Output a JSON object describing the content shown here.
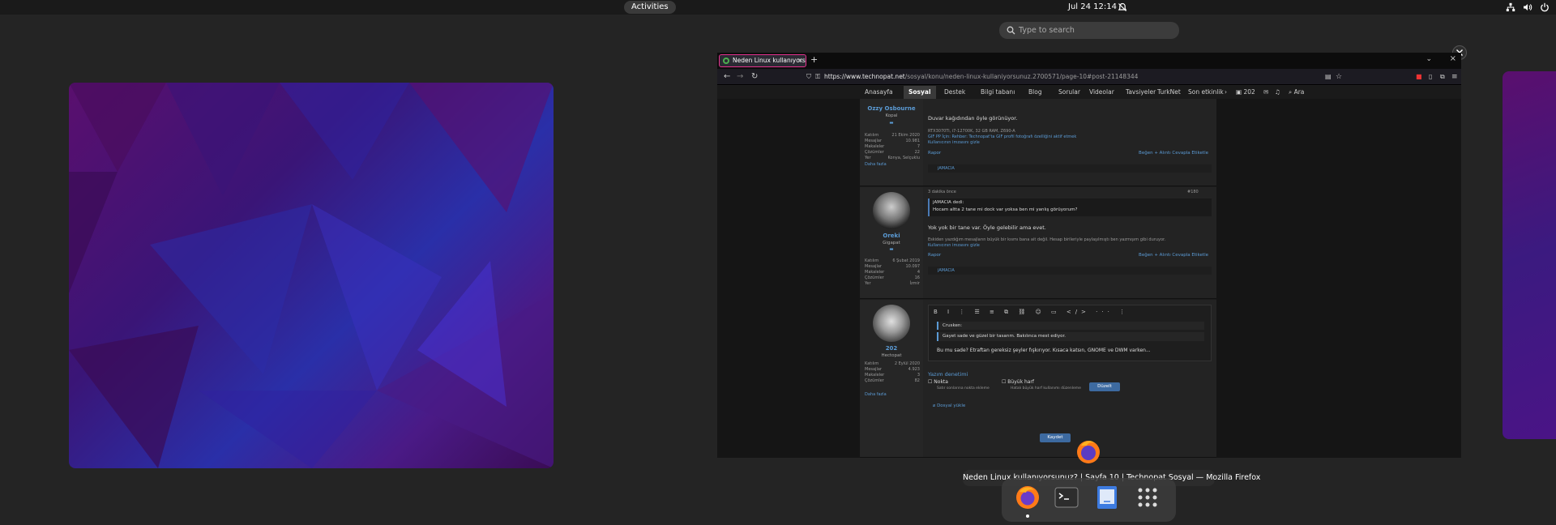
{
  "topbar": {
    "activities": "Activities",
    "clock": "Jul 24  12:14"
  },
  "search": {
    "placeholder": "Type to search"
  },
  "firefox": {
    "tab_title": "Neden Linux kullanıyorsu...",
    "url_host": "https://www.technopat.net",
    "url_path": "/sosyal/konu/neden-linux-kullaniyorsunuz.2700571/page-10#post-21148344",
    "tooltip": "Neden Linux kullanıyorsunuz? | Sayfa 10 | Technopat Sosyal — Mozilla Firefox"
  },
  "site_nav": {
    "items": [
      "Anasayfa",
      "Sosyal",
      "Destek",
      "Bilgi tabanı",
      "Blog",
      "Sorular",
      "Videolar",
      "Tavsiyeler",
      "TurkNet",
      "Son etkinlik"
    ],
    "user": "202",
    "search": "Ara"
  },
  "post1": {
    "username": "Ozzy Osbourne",
    "role": "Kopal",
    "stats": [
      {
        "k": "Katılım",
        "v": "21 Ekim 2020"
      },
      {
        "k": "Mesajlar",
        "v": "10.981"
      },
      {
        "k": "Makaleler",
        "v": "7"
      },
      {
        "k": "Çözümler",
        "v": "22"
      },
      {
        "k": "Yer",
        "v": "Konya, Selçuklu"
      }
    ],
    "more": "Daha fazla",
    "text": "Duvar kağıdından öyle görünüyor.",
    "sig_line1": "RTX3070Ti, i7-12700K, 32 GB RAM, Z690-A",
    "sig_line2": "GIF PP İçin: Rehber: Technopat'ta GIF profil fotoğrafı özelliğini aktif etmek",
    "sig_line3": "Kullanıcının imzasını gizle",
    "report": "Rapor",
    "actions": "Beğen   + Alıntı   Cevapla   Etiketle",
    "reaction": "jAMACIA"
  },
  "post2": {
    "time": "3 dakika önce",
    "post_no": "#180",
    "username": "Oreki",
    "role": "Gigapat",
    "stats": [
      {
        "k": "Katılım",
        "v": "6 Şubat 2019"
      },
      {
        "k": "Mesajlar",
        "v": "10.097"
      },
      {
        "k": "Makaleler",
        "v": "4"
      },
      {
        "k": "Çözümler",
        "v": "16"
      },
      {
        "k": "Yer",
        "v": "İzmir"
      }
    ],
    "more": "Daha fazla",
    "quote_author": "jAMACIA dedi:",
    "quote_text": "Hocam altta 2 tane mi dock var yoksa ben mi yanlış görüyorum?",
    "text": "Yok yok bir tane var. Öyle gelebilir ama evet.",
    "sig_line1": "Eskiden yazdığım mesajların büyük bir kısmı bana ait değil. Hesap birileriyle paylaşılmıştı ben yazmışım gibi duruyor.",
    "sig_line2": "Kullanıcının imzasını gizle",
    "report": "Rapor",
    "actions": "Beğen   + Alıntı   Cevapla   Etiketle",
    "reaction": "jAMACIA"
  },
  "reply": {
    "username": "202",
    "role": "Hectopat",
    "stats": [
      {
        "k": "Katılım",
        "v": "2 Eylül 2020"
      },
      {
        "k": "Mesajlar",
        "v": "4.923"
      },
      {
        "k": "Makaleler",
        "v": "3"
      },
      {
        "k": "Çözümler",
        "v": "82"
      }
    ],
    "more": "Daha fazla",
    "toolbar": "B I ⋮ ☰ ≡ ⧉ ⛓ ☺ ▭ </> ··· ⋮",
    "quote_author": "Crusken:",
    "quote_text": "Gayet sade ve güzel bir tasarım. Bakılınca mest ediyor.",
    "text": "Bu mu sade? Etraftan gereksiz şeyler fışkırıyor. Kısaca katsın, GNOME ve DWM varken...",
    "spell_title": "Yazım denetimi",
    "check1": "Nokta",
    "check1_sub": "Satır sonlarına nokta ekleme",
    "check2": "Büyük harf",
    "check2_sub": "Hatalı büyük harf kullanımı düzenleme",
    "fix_button": "Düzelt",
    "attach": "Dosyal yükle",
    "save_button": "Kaydet"
  },
  "colors": {
    "accent": "#5b9bd5",
    "tab_border": "#e5318e",
    "wallpaper_1": "#5a0f6e",
    "wallpaper_2": "#2a2fa8"
  }
}
